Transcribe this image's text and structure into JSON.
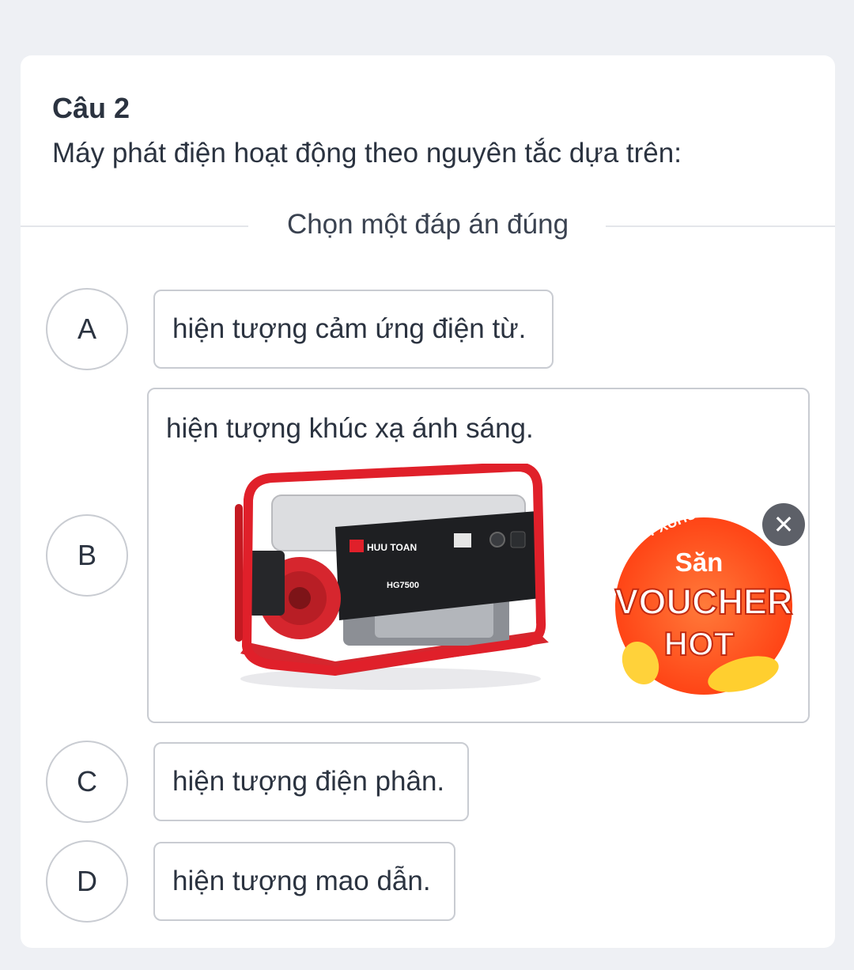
{
  "question": {
    "number": "Câu 2",
    "text": "Máy phát điện hoạt động theo nguyên tắc dựa trên:"
  },
  "instruction": "Chọn một đáp án đúng",
  "options": [
    {
      "letter": "A",
      "text": "hiện tượng cảm ứng điện từ."
    },
    {
      "letter": "B",
      "text": "hiện tượng khúc xạ ánh sáng."
    },
    {
      "letter": "C",
      "text": "hiện tượng điện phân."
    },
    {
      "letter": "D",
      "text": "hiện tượng mao dẫn."
    }
  ],
  "generator_image": {
    "brand": "HUU TOAN",
    "model": "HG7500"
  },
  "ad_badge": {
    "hashtag": "#SHOPXUHUONG",
    "line1": "Săn",
    "line2": "VOUCHER",
    "line3": "HOT",
    "close_symbol": "✕"
  },
  "colors": {
    "frame_red": "#e0202a",
    "badge_orange": "#ff5a1e",
    "badge_yellow": "#ffd23a"
  }
}
